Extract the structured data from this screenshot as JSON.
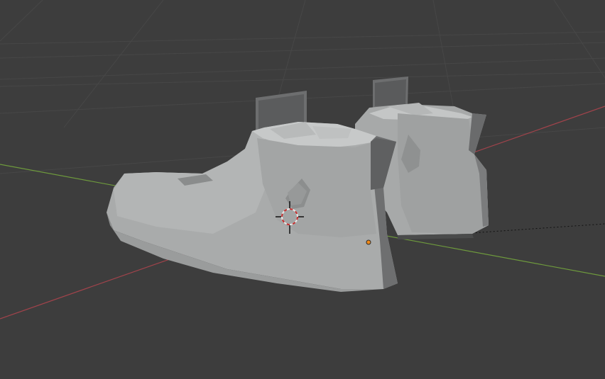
{
  "viewport": {
    "background": "#3d3d3d",
    "grid_color": "#474747",
    "x_axis_color": "#a0434b",
    "y_axis_color": "#6e9a3d"
  },
  "scene": {
    "objects": [
      {
        "name": "boot-left",
        "material_color": "#a9abab"
      },
      {
        "name": "boot-right",
        "material_color": "#a9abab"
      }
    ],
    "cursor_3d": {
      "icon": "3d-cursor-icon",
      "ring_colors": [
        "#d8d8d8",
        "#c43030"
      ]
    },
    "origin_marker": {
      "icon": "object-origin-dot",
      "color": "#f08a1a"
    }
  }
}
